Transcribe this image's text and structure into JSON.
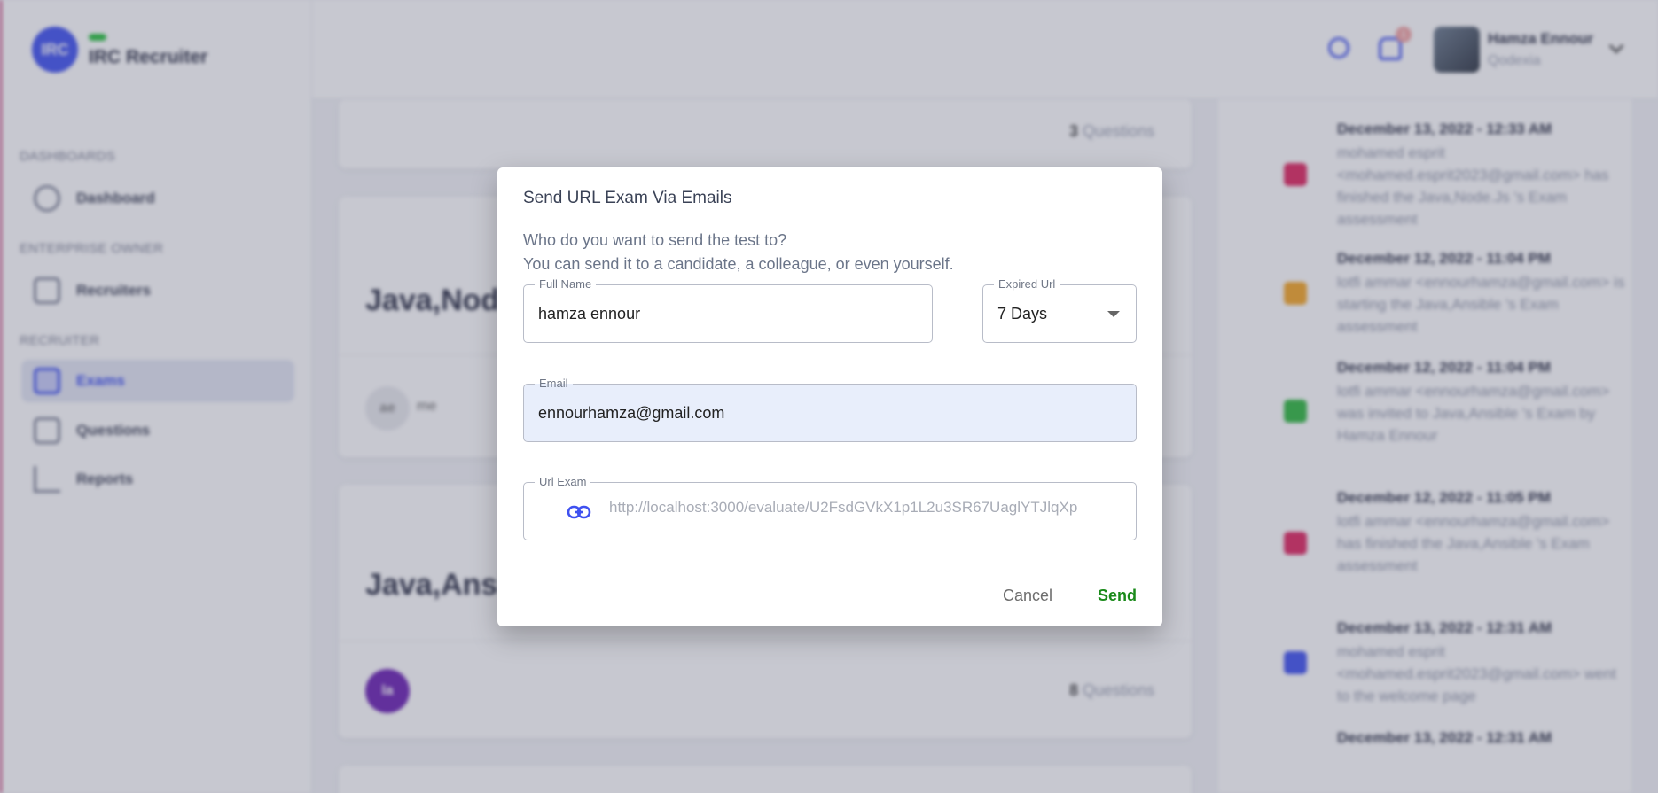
{
  "app": {
    "logo_initials": "IRC",
    "name": "IRC Recruiter"
  },
  "sidebar": {
    "sections": [
      {
        "label": "DASHBOARDS"
      },
      {
        "label": "ENTERPRISE OWNER"
      },
      {
        "label": "RECRUITER"
      }
    ],
    "items": [
      {
        "label": "Dashboard",
        "icon": "gear-icon"
      },
      {
        "label": "Recruiters",
        "icon": "recruiters-icon"
      },
      {
        "label": "Exams",
        "icon": "exams-icon",
        "active": true
      },
      {
        "label": "Questions",
        "icon": "questions-icon"
      },
      {
        "label": "Reports",
        "icon": "reports-icon"
      }
    ]
  },
  "topbar": {
    "notification_count": "1",
    "user_name": "Hamza Ennour",
    "user_company": "Qodexia"
  },
  "exams": [
    {
      "title": "",
      "question_count": "3",
      "questions_label": "Questions"
    },
    {
      "title": "Java,Node",
      "avatar": "ae",
      "avatar_label": "me"
    },
    {
      "title": "Java,Ansib",
      "avatar": "la",
      "question_count": "8",
      "questions_label": "Questions"
    }
  ],
  "activity": [
    {
      "date": "December 13, 2022 - 12:33 AM",
      "text": "mohamed esprit <mohamed.esprit2023@gmail.com> has finished the Java,Node.Js 's Exam assessment",
      "icon_color": "#e0245e"
    },
    {
      "date": "December 12, 2022 - 11:04 PM",
      "text": "lotfi ammar <ennourhamza@gmail.com> is starting the Java,Ansible 's Exam assessment",
      "icon_color": "#f5a623"
    },
    {
      "date": "December 12, 2022 - 11:04 PM",
      "text": "lotfi ammar <ennourhamza@gmail.com> was invited to Java,Ansible 's Exam by Hamza Ennour",
      "icon_color": "#2db83d"
    },
    {
      "date": "December 12, 2022 - 11:05 PM",
      "text": "lotfi ammar <ennourhamza@gmail.com> has finished the Java,Ansible 's Exam assessment",
      "icon_color": "#e0245e"
    },
    {
      "date": "December 13, 2022 - 12:31 AM",
      "text": "mohamed esprit <mohamed.esprit2023@gmail.com> went to the welcome page",
      "icon_color": "#3f51f0"
    },
    {
      "date": "December 13, 2022 - 12:31 AM",
      "text": "",
      "icon_color": "#3f51f0"
    }
  ],
  "dialog": {
    "title": "Send URL Exam Via Emails",
    "subtitle_line1": "Who do you want to send the test to?",
    "subtitle_line2": "You can send it to a candidate, a colleague, or even yourself.",
    "full_name": {
      "label": "Full Name",
      "value": "hamza ennour"
    },
    "expired_url": {
      "label": "Expired Url",
      "value": "7 Days"
    },
    "email": {
      "label": "Email",
      "value": "ennourhamza@gmail.com"
    },
    "url_exam": {
      "label": "Url Exam",
      "placeholder": "http://localhost:3000/evaluate/U2FsdGVkX1p1L2u3SR67UaglYTJlqXp"
    },
    "cancel_label": "Cancel",
    "send_label": "Send"
  }
}
